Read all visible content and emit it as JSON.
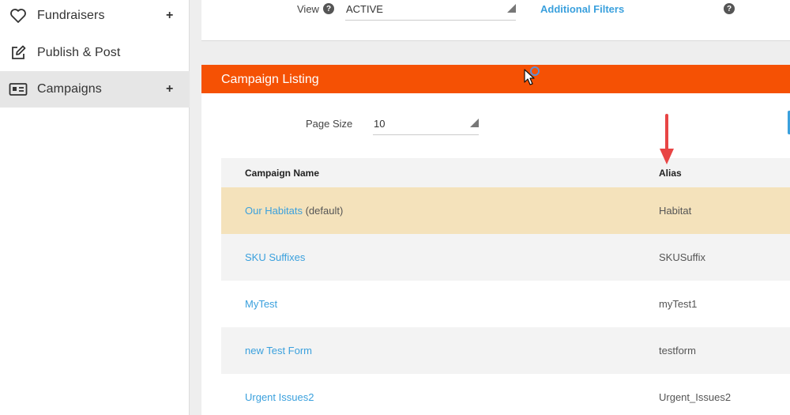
{
  "sidebar": {
    "items": [
      {
        "label": "Fundraisers",
        "icon": "heart-icon",
        "expand": "+"
      },
      {
        "label": "Publish & Post",
        "icon": "edit-icon",
        "expand": ""
      },
      {
        "label": "Campaigns",
        "icon": "id-card-icon",
        "expand": "+"
      }
    ],
    "active_index": 2
  },
  "filters": {
    "view_label": "View",
    "view_value": "ACTIVE",
    "additional_filters": "Additional Filters",
    "help_glyph": "?"
  },
  "listing": {
    "title": "Campaign Listing",
    "page_size_label": "Page Size",
    "page_size_value": "10",
    "columns": [
      "Campaign Name",
      "Alias"
    ],
    "rows": [
      {
        "name": "Our Habitats",
        "suffix": " (default)",
        "alias": "Habitat"
      },
      {
        "name": "SKU Suffixes",
        "suffix": "",
        "alias": "SKUSuffix"
      },
      {
        "name": "MyTest",
        "suffix": "",
        "alias": "myTest1"
      },
      {
        "name": "new Test Form",
        "suffix": "",
        "alias": "testform"
      },
      {
        "name": "Urgent Issues2",
        "suffix": "",
        "alias": "Urgent_Issues2"
      }
    ],
    "highlighted_row": 0
  },
  "colors": {
    "accent_orange": "#f55104",
    "link_blue": "#3aa0dd",
    "highlight_row": "#f4e2bb",
    "annotation_arrow": "#e84545"
  }
}
